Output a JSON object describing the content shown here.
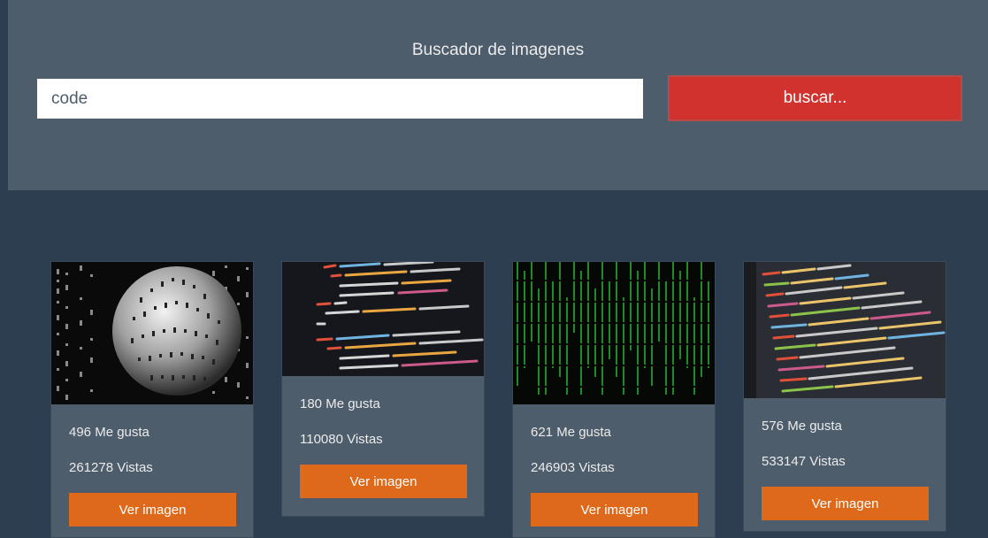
{
  "header": {
    "title": "Buscador de imagenes",
    "search_value": "code",
    "search_button_label": "buscar..."
  },
  "colors": {
    "background": "#2d3e50",
    "panel": "#4e5d6c",
    "danger": "#d2322d",
    "warning": "#df691a"
  },
  "results": [
    {
      "likes": "496 Me gusta",
      "views": "261278 Vistas",
      "button_label": "Ver imagen",
      "image": "binary-sphere"
    },
    {
      "likes": "180 Me gusta",
      "views": "110080 Vistas",
      "button_label": "Ver imagen",
      "image": "code-screen-red"
    },
    {
      "likes": "621 Me gusta",
      "views": "246903 Vistas",
      "button_label": "Ver imagen",
      "image": "matrix-rain"
    },
    {
      "likes": "576 Me gusta",
      "views": "533147 Vistas",
      "button_label": "Ver imagen",
      "image": "code-screen-perspective"
    }
  ]
}
